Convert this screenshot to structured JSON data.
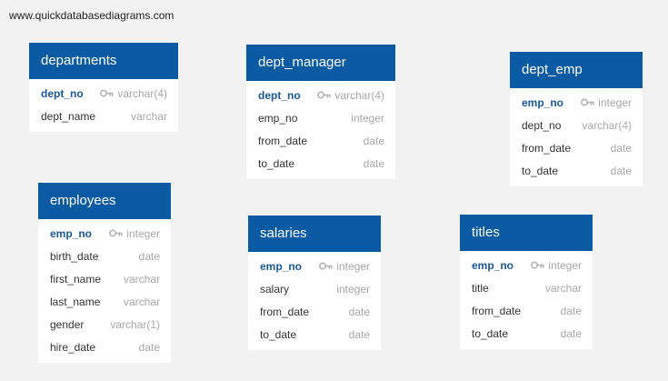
{
  "watermark": "www.quickdatabasediagrams.com",
  "colors": {
    "header": "#0a5aa4",
    "pk_text": "#1a5aa0",
    "type_text": "#a8a8a8"
  },
  "tables": {
    "departments": {
      "title": "departments",
      "columns": [
        {
          "name": "dept_no",
          "type": "varchar(4)",
          "pk": true
        },
        {
          "name": "dept_name",
          "type": "varchar",
          "pk": false
        }
      ]
    },
    "dept_manager": {
      "title": "dept_manager",
      "columns": [
        {
          "name": "dept_no",
          "type": "varchar(4)",
          "pk": true
        },
        {
          "name": "emp_no",
          "type": "integer",
          "pk": false
        },
        {
          "name": "from_date",
          "type": "date",
          "pk": false
        },
        {
          "name": "to_date",
          "type": "date",
          "pk": false
        }
      ]
    },
    "dept_emp": {
      "title": "dept_emp",
      "columns": [
        {
          "name": "emp_no",
          "type": "integer",
          "pk": true
        },
        {
          "name": "dept_no",
          "type": "varchar(4)",
          "pk": false
        },
        {
          "name": "from_date",
          "type": "date",
          "pk": false
        },
        {
          "name": "to_date",
          "type": "date",
          "pk": false
        }
      ]
    },
    "employees": {
      "title": "employees",
      "columns": [
        {
          "name": "emp_no",
          "type": "integer",
          "pk": true
        },
        {
          "name": "birth_date",
          "type": "date",
          "pk": false
        },
        {
          "name": "first_name",
          "type": "varchar",
          "pk": false
        },
        {
          "name": "last_name",
          "type": "varchar",
          "pk": false
        },
        {
          "name": "gender",
          "type": "varchar(1)",
          "pk": false
        },
        {
          "name": "hire_date",
          "type": "date",
          "pk": false
        }
      ]
    },
    "salaries": {
      "title": "salaries",
      "columns": [
        {
          "name": "emp_no",
          "type": "integer",
          "pk": true
        },
        {
          "name": "salary",
          "type": "integer",
          "pk": false
        },
        {
          "name": "from_date",
          "type": "date",
          "pk": false
        },
        {
          "name": "to_date",
          "type": "date",
          "pk": false
        }
      ]
    },
    "titles": {
      "title": "titles",
      "columns": [
        {
          "name": "emp_no",
          "type": "integer",
          "pk": true
        },
        {
          "name": "title",
          "type": "varchar",
          "pk": false
        },
        {
          "name": "from_date",
          "type": "date",
          "pk": false
        },
        {
          "name": "to_date",
          "type": "date",
          "pk": false
        }
      ]
    }
  }
}
